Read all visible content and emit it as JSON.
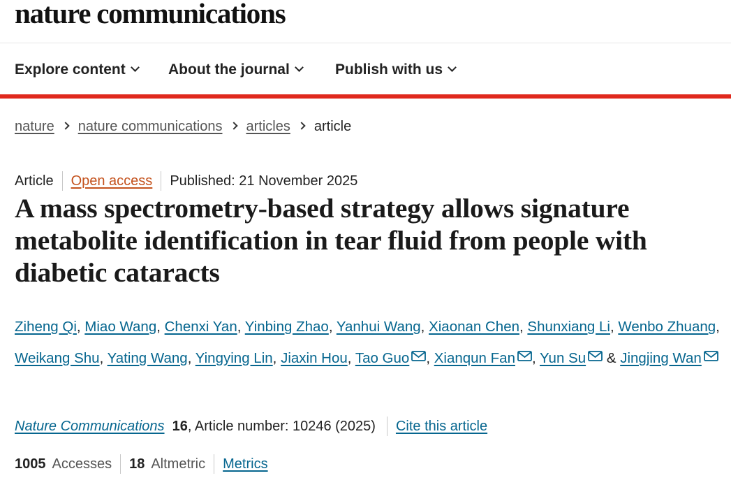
{
  "header": {
    "brand": "nature communications"
  },
  "nav": {
    "items": [
      {
        "label": "Explore content"
      },
      {
        "label": "About the journal"
      },
      {
        "label": "Publish with us"
      }
    ]
  },
  "breadcrumb": {
    "items": [
      "nature",
      "nature communications",
      "articles"
    ],
    "current": "article"
  },
  "article": {
    "type": "Article",
    "access": "Open access",
    "published": "Published: 21 November 2025",
    "title": "A mass spectrometry-based strategy allows signature metabolite identification in tear fluid from people with diabetic cataracts",
    "authors": [
      "Ziheng Qi",
      "Miao Wang",
      "Chenxi Yan",
      "Yinbing Zhao",
      "Yanhui Wang",
      "Xiaonan Chen",
      "Shunxiang Li",
      "Wenbo Zhuang",
      "Weikang Shu",
      "Yating Wang",
      "Yingying Lin",
      "Jiaxin Hou",
      "Tao Guo",
      "Xianqun Fan",
      "Yun Su",
      "Jingjing Wan"
    ],
    "author_separator": ", ",
    "author_final_separator": " & "
  },
  "citation": {
    "journal": "Nature Communications",
    "volume": "16",
    "details": ", Article number: 10246 (2025)",
    "cite_label": "Cite this article"
  },
  "metrics": {
    "accesses_count": "1005",
    "accesses_label": "Accesses",
    "altmetric_count": "18",
    "altmetric_label": "Altmetric",
    "metrics_link": "Metrics"
  },
  "colors": {
    "accent_bar": "#e0291d",
    "link": "#06668f",
    "open_access": "#c4521d"
  },
  "icons": {
    "nav_chevron": "chevron-down-icon",
    "breadcrumb_separator": "chevron-right-icon",
    "author_email": "mail-icon"
  }
}
